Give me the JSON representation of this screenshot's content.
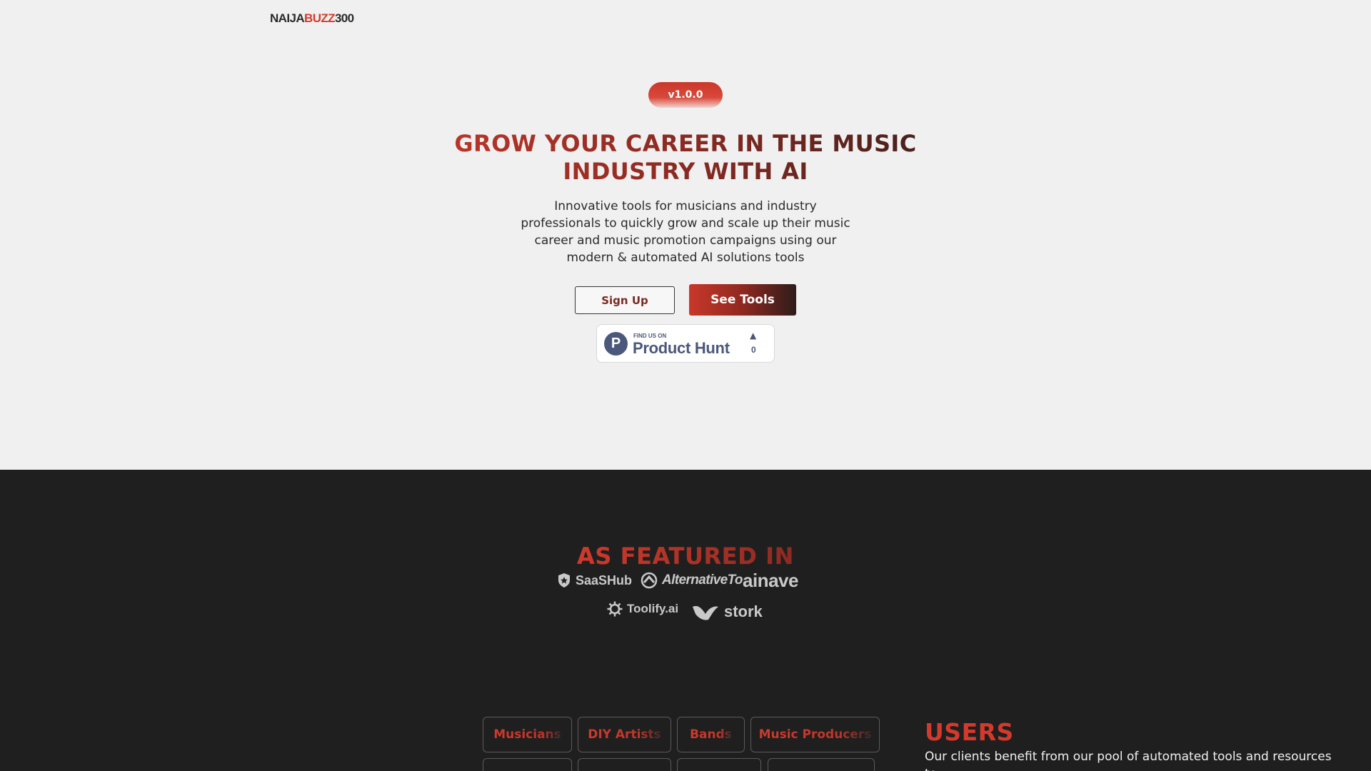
{
  "header": {
    "logo_part1": "NAIJA",
    "logo_part2": "BUZZ",
    "logo_part3": "300"
  },
  "hero": {
    "version": "v1.0.0",
    "headline": "GROW YOUR CAREER IN THE MUSIC INDUSTRY WITH AI",
    "subtitle": "Innovative tools for musicians and industry professionals to quickly grow and scale up their music career and music promotion campaigns using our modern & automated AI solutions tools",
    "signup_label": "Sign Up",
    "see_tools_label": "See Tools",
    "product_hunt": {
      "small_text": "FIND US ON",
      "name": "Product Hunt",
      "logo_letter": "P",
      "arrow": "▲",
      "upvotes": "0"
    }
  },
  "featured": {
    "title": "AS FEATURED IN",
    "logos": [
      "SaaSHub",
      "AlternativeTo",
      "ainave",
      "Toolify.ai",
      "stork"
    ]
  },
  "audiences": {
    "items": [
      "Musicians",
      "DIY Artists",
      "Bands",
      "Music Producers"
    ]
  },
  "users": {
    "title": "USERS",
    "text": "Our clients benefit from our pool of automated tools and resources to"
  },
  "colors": {
    "accent": "#d33a2c",
    "dark_bg": "#1f1f1f",
    "light_bg": "#f0f0f0"
  }
}
